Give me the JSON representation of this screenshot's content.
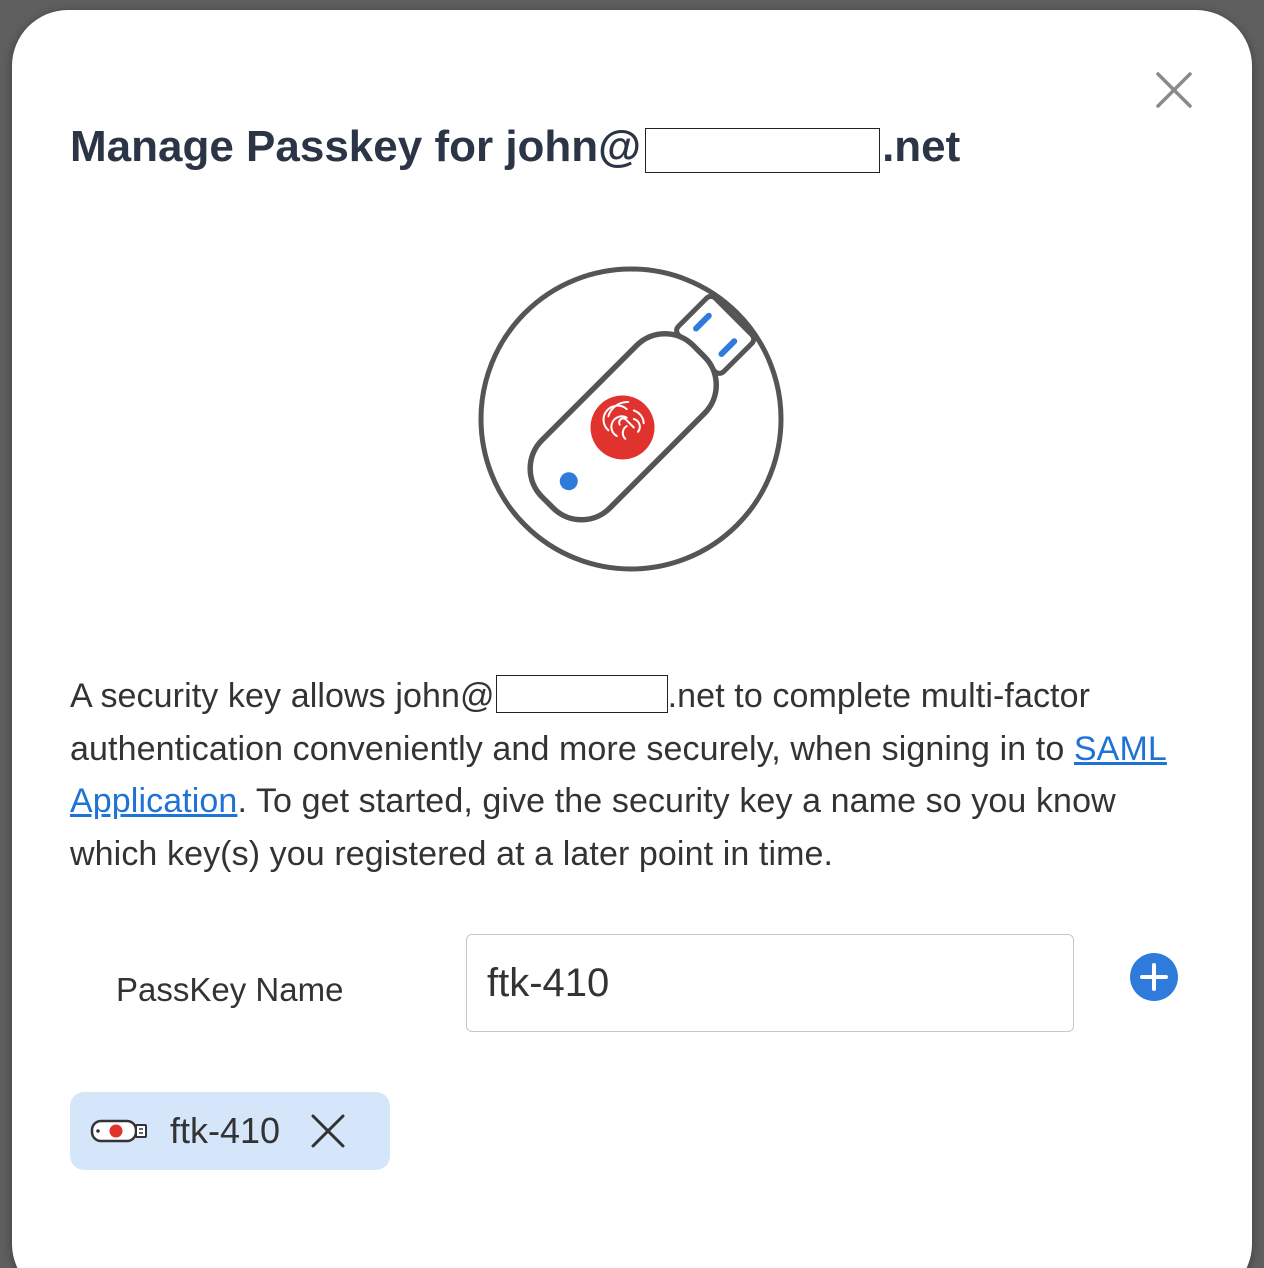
{
  "dialog": {
    "title_prefix": "Manage Passkey for john@",
    "title_suffix": ".net",
    "close_icon": "close-icon"
  },
  "illustration": {
    "icon": "usb-security-key-fingerprint-icon",
    "colors": {
      "outline": "#555555",
      "fingerprint_bg": "#e0332d",
      "accent_blue": "#2f7bdc"
    }
  },
  "description": {
    "part1": "A security key allows john@",
    "part2": ".net to complete multi-factor authentication conveniently and more securely, when signing in to ",
    "link_text": "SAML Application",
    "part3": ". To get started, give the security key a name so you know which key(s) you registered at a later point in time."
  },
  "form": {
    "label": "PassKey Name",
    "input_value": "ftk-410",
    "add_icon": "plus-circle-icon",
    "add_color": "#2f7bdc"
  },
  "keys": [
    {
      "label": "ftk-410",
      "icon": "security-key-icon",
      "remove_icon": "close-icon"
    }
  ]
}
